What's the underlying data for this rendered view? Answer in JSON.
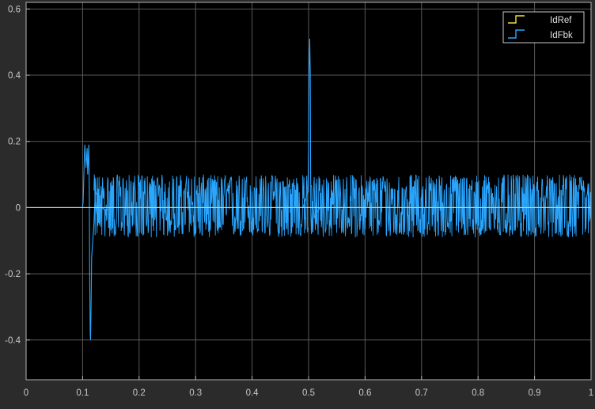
{
  "chart_data": {
    "type": "line",
    "title": "",
    "xlabel": "",
    "ylabel": "",
    "xlim": [
      0,
      1
    ],
    "ylim": [
      -0.52,
      0.62
    ],
    "grid": true,
    "legend_position": "top-right",
    "x_ticks": [
      "0",
      "0.1",
      "0.2",
      "0.3",
      "0.4",
      "0.5",
      "0.6",
      "0.7",
      "0.8",
      "0.9",
      "1"
    ],
    "y_ticks": [
      "0.6",
      "0.4",
      "0.2",
      "0",
      "-0.2",
      "-0.4"
    ],
    "colors": {
      "figure_background": "#2b2b2b",
      "axes_background": "#000000",
      "grid": "#5a5a5a",
      "axis_lines": "#b4b4b4",
      "tick_text": "#c8c8c8",
      "legend_border": "#c8c8c8"
    },
    "series": [
      {
        "name": "IdRef",
        "color": "#f0e040",
        "x": [
          0.0,
          0.1,
          0.1,
          0.118,
          0.118,
          1.0
        ],
        "y": [
          0.0,
          0.0,
          0.0,
          0.0,
          0.0,
          0.0
        ]
      },
      {
        "name": "IdFbk",
        "color": "#2aa6ff",
        "x": [
          0.0,
          0.1,
          0.101,
          0.103,
          0.104,
          0.106,
          0.108,
          0.109,
          0.111,
          0.112,
          0.1125,
          0.1135,
          0.114,
          0.115,
          0.116,
          0.118,
          0.12,
          0.122,
          0.125,
          0.13,
          0.14,
          0.15,
          0.2,
          0.3,
          0.4,
          0.49,
          0.499,
          0.5,
          0.501,
          0.502,
          0.503,
          0.5035,
          0.504,
          0.505,
          0.507,
          0.51,
          0.52,
          0.6,
          0.7,
          0.8,
          0.9,
          1.0
        ],
        "y": [
          0.0,
          0.0,
          0.02,
          0.15,
          0.19,
          0.12,
          0.18,
          0.1,
          0.19,
          0.02,
          -0.2,
          -0.38,
          -0.4,
          -0.3,
          -0.15,
          -0.1,
          -0.05,
          0.03,
          -0.02,
          0.01,
          -0.01,
          0.0,
          0.0,
          0.0,
          0.0,
          0.0,
          0.05,
          0.2,
          0.42,
          0.51,
          0.4,
          0.15,
          -0.02,
          -0.08,
          0.02,
          -0.03,
          0.0,
          0.0,
          0.0,
          0.0,
          0.0,
          0.0
        ],
        "noise_band": {
          "segments": [
            {
              "x_start": 0.12,
              "x_end": 0.499,
              "low": -0.09,
              "high": 0.1
            },
            {
              "x_start": 0.505,
              "x_end": 1.0,
              "low": -0.09,
              "high": 0.1
            }
          ]
        }
      }
    ]
  }
}
